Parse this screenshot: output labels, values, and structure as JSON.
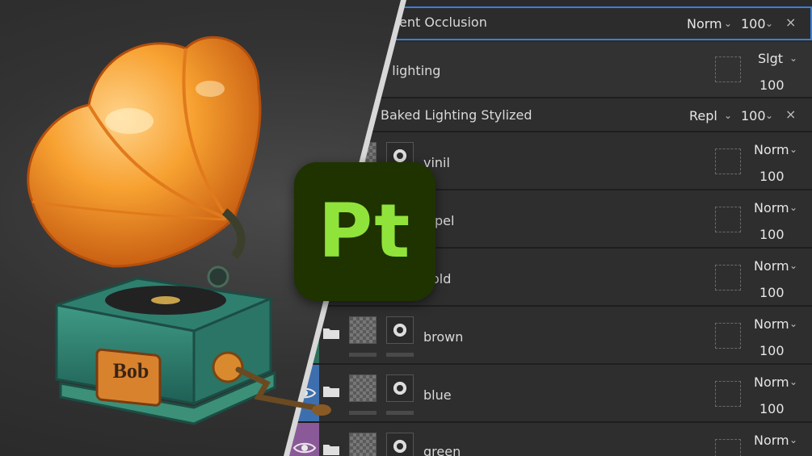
{
  "logo": {
    "text": "Pt",
    "bg": "#1f3300",
    "fg": "#90e33b"
  },
  "gramophone": {
    "plate_text": "Bob"
  },
  "accent": "#3b7fd4",
  "layers": [
    {
      "name": "ent Occlusion",
      "blend": "Norm",
      "opacity": "100",
      "type": "fill-effect",
      "selected": true,
      "close": "×"
    },
    {
      "name": "d lighting",
      "blend": "Slgt",
      "opacity": "100",
      "type": "group"
    },
    {
      "name": "Baked Lighting Stylized",
      "blend": "Repl",
      "opacity": "100",
      "type": "fill-effect",
      "close": "×"
    },
    {
      "name": "vinil",
      "blend": "Norm",
      "opacity": "100",
      "type": "layer"
    },
    {
      "name": "pel",
      "blend": "Norm",
      "opacity": "100",
      "type": "layer"
    },
    {
      "name": "old",
      "blend": "Norm",
      "opacity": "100",
      "type": "layer"
    },
    {
      "name": "brown",
      "blend": "Norm",
      "opacity": "100",
      "type": "layer"
    },
    {
      "name": "blue",
      "blend": "Norm",
      "opacity": "100",
      "type": "layer",
      "color": "#3d6fae"
    },
    {
      "name": "green",
      "blend": "Norm",
      "opacity": "",
      "type": "layer",
      "color": "#8a5a98"
    }
  ]
}
